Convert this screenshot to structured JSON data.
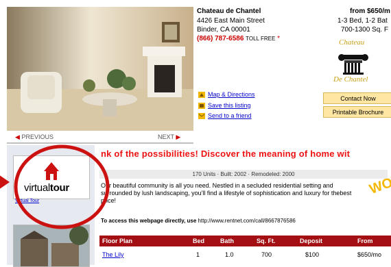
{
  "property": {
    "name": "Chateau de Chantel",
    "address_line1": "4426 East Main Street",
    "address_line2": "Binder, CA 00001",
    "phone": "(866) 787-6586",
    "toll_free": "TOLL FREE",
    "phone_star": "*",
    "price": "from $650/m",
    "beds_baths": "1-3 Bed, 1-2 Bat",
    "sqft": "700-1300 Sq. F",
    "logo_text_top": "Chateau",
    "logo_text_bottom": "De Chantel"
  },
  "nav": {
    "prev_arrow": "◀",
    "prev": "PREVIOUS",
    "next": "NEXT",
    "next_arrow": "▶"
  },
  "links": {
    "map": "Map & Directions",
    "save": "Save this listing",
    "send": "Send to a friend"
  },
  "buttons": {
    "contact": "Contact Now",
    "brochure": "Printable Brochure"
  },
  "virtual_tour": {
    "logo_plain": "virtual",
    "logo_bold": "tour",
    "label": "Virtual Tour"
  },
  "tagline": "nk of the possibilities!   Discover the meaning of home wit",
  "stats": "170 Units  ·  Built: 2002  ·  Remodeled: 2000",
  "description": "Our beautiful community is all you need. Nestled in a secluded residential setting and surrounded by lush landscaping, you'll find a lifestyle of sophistication and luxury for thebest price!",
  "access": {
    "label": "To access this webpage directly, use",
    "url": "http://www.rentnet.com/call/8667876586"
  },
  "wow": "WOW",
  "table": {
    "headers": [
      "Floor Plan",
      "Bed",
      "Bath",
      "Sq. Ft.",
      "Deposit",
      "From"
    ],
    "rows": [
      {
        "plan": "The Lily",
        "bed": "1",
        "bath": "1.0",
        "sqft": "700",
        "deposit": "$100",
        "from": "$650/mo"
      }
    ]
  },
  "colors": {
    "accent_red": "#a40f14",
    "tagline_red": "#ee1111",
    "button_bg": "#ffe7a3",
    "link_blue": "#0000cc"
  }
}
